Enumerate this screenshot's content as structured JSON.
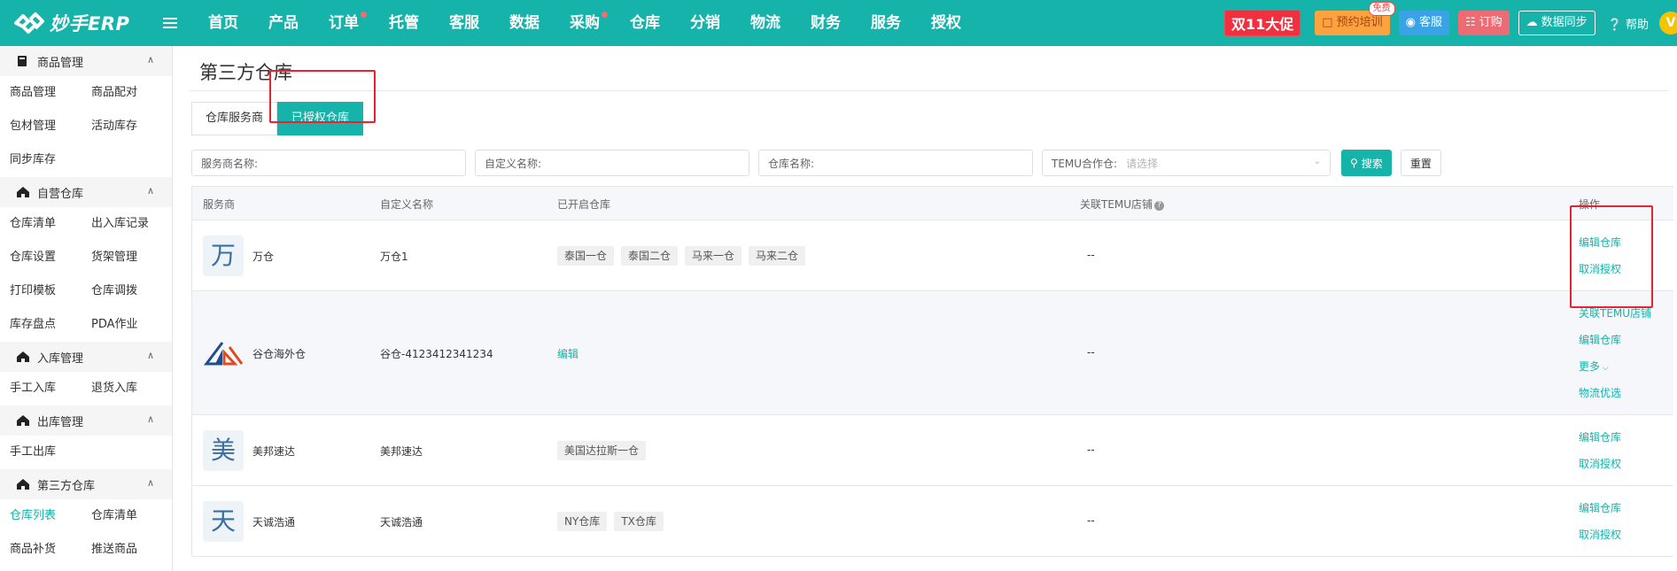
{
  "brand": {
    "name": "妙手ERP"
  },
  "nav": [
    {
      "label": "首页",
      "dot": false
    },
    {
      "label": "产品",
      "dot": false
    },
    {
      "label": "订单",
      "dot": true
    },
    {
      "label": "托管",
      "dot": false
    },
    {
      "label": "客服",
      "dot": false
    },
    {
      "label": "数据",
      "dot": false
    },
    {
      "label": "采购",
      "dot": true
    },
    {
      "label": "仓库",
      "dot": false
    },
    {
      "label": "分销",
      "dot": false
    },
    {
      "label": "物流",
      "dot": false
    },
    {
      "label": "财务",
      "dot": false
    },
    {
      "label": "服务",
      "dot": false
    },
    {
      "label": "授权",
      "dot": false
    }
  ],
  "topright": {
    "promo": "双11大促",
    "training": "预约培训",
    "training_badge": "免费",
    "service": "客服",
    "order": "订购",
    "sync": "数据同步",
    "help": "帮助",
    "avatar_letter": "V"
  },
  "sidebar": {
    "groups": [
      {
        "title": "商品管理",
        "icon": "product-icon",
        "items": [
          "商品管理",
          "商品配对",
          "包材管理",
          "活动库存",
          "同步库存"
        ]
      },
      {
        "title": "自营仓库",
        "icon": "house-icon",
        "items": [
          "仓库清单",
          "出入库记录",
          "仓库设置",
          "货架管理",
          "打印模板",
          "仓库调拨",
          "库存盘点",
          "PDA作业"
        ]
      },
      {
        "title": "入库管理",
        "icon": "house-icon",
        "items": [
          "手工入库",
          "退货入库"
        ]
      },
      {
        "title": "出库管理",
        "icon": "house-icon",
        "items": [
          "手工出库"
        ]
      },
      {
        "title": "第三方仓库",
        "icon": "house-icon",
        "items": [
          "仓库列表",
          "仓库清单",
          "商品补货",
          "推送商品"
        ],
        "active_index": 0
      }
    ]
  },
  "page": {
    "title": "第三方仓库",
    "tabs": [
      "仓库服务商",
      "已授权仓库"
    ],
    "active_tab": 1
  },
  "filters": {
    "provider_label": "服务商名称:",
    "custom_label": "自定义名称:",
    "warehouse_label": "仓库名称:",
    "temu_label": "TEMU合作仓:",
    "temu_placeholder": "请选择",
    "search": "搜索",
    "reset": "重置"
  },
  "table": {
    "headers": [
      "服务商",
      "自定义名称",
      "已开启仓库",
      "关联TEMU店铺",
      "操作"
    ],
    "rows": [
      {
        "logo_char": "万",
        "logo_kind": "char",
        "provider": "万仓",
        "custom": "万仓1",
        "warehouses": [
          "泰国一仓",
          "泰国二仓",
          "马来一仓",
          "马来二仓"
        ],
        "edit_link": "",
        "temu": "--",
        "ops": [
          "编辑仓库",
          "取消授权"
        ]
      },
      {
        "logo_char": "",
        "logo_kind": "gc",
        "provider": "谷仓海外仓",
        "custom": "谷仓-4123412341234",
        "warehouses": [],
        "edit_link": "编辑",
        "temu": "--",
        "ops": [
          "关联TEMU店铺",
          "编辑仓库",
          "更多",
          "物流优选"
        ]
      },
      {
        "logo_char": "美",
        "logo_kind": "char",
        "provider": "美邦速达",
        "custom": "美邦速达",
        "warehouses": [
          "美国达拉斯一仓"
        ],
        "edit_link": "",
        "temu": "--",
        "ops": [
          "编辑仓库",
          "取消授权"
        ]
      },
      {
        "logo_char": "天",
        "logo_kind": "char",
        "provider": "天诚浩通",
        "custom": "天诚浩通",
        "warehouses": [
          "NY仓库",
          "TX仓库"
        ],
        "edit_link": "",
        "temu": "--",
        "ops": [
          "编辑仓库",
          "取消授权"
        ]
      }
    ]
  },
  "colors": {
    "brand": "#15b3aa",
    "highlight": "#e8232f"
  }
}
